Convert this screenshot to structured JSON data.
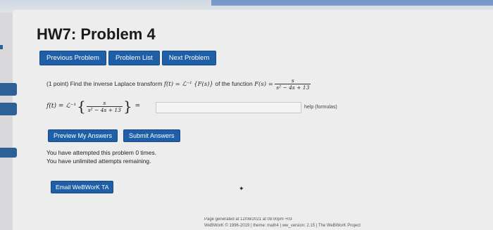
{
  "page_title": "HW7: Problem 4",
  "nav": {
    "previous": "Previous Problem",
    "list": "Problem List",
    "next": "Next Problem"
  },
  "problem": {
    "points": "(1 point)",
    "statement": "Find the inverse Laplace transform",
    "transform_expr": "f(t) = ℒ⁻¹ {F(s)}",
    "of_function": "of the function",
    "function_lhs": "F(s) =",
    "numerator": "s",
    "denominator": "s² − 4s + 13"
  },
  "answer": {
    "lhs": "f(t) = ℒ⁻¹",
    "equals": "=",
    "value": "",
    "help_link": "help (formulas)"
  },
  "actions": {
    "preview": "Preview My Answers",
    "submit": "Submit Answers"
  },
  "attempts": {
    "line1": "You have attempted this problem 0 times.",
    "line2": "You have unlimited attempts remaining."
  },
  "email_button": "Email WeBWorK TA",
  "footer": {
    "line1": "Page generated at 12/08/2021 at 08:00pm +03",
    "line2": "WeBWorK © 1996-2019 | theme: math4 | ww_version: 2.15 | The WeBWorK Project"
  }
}
